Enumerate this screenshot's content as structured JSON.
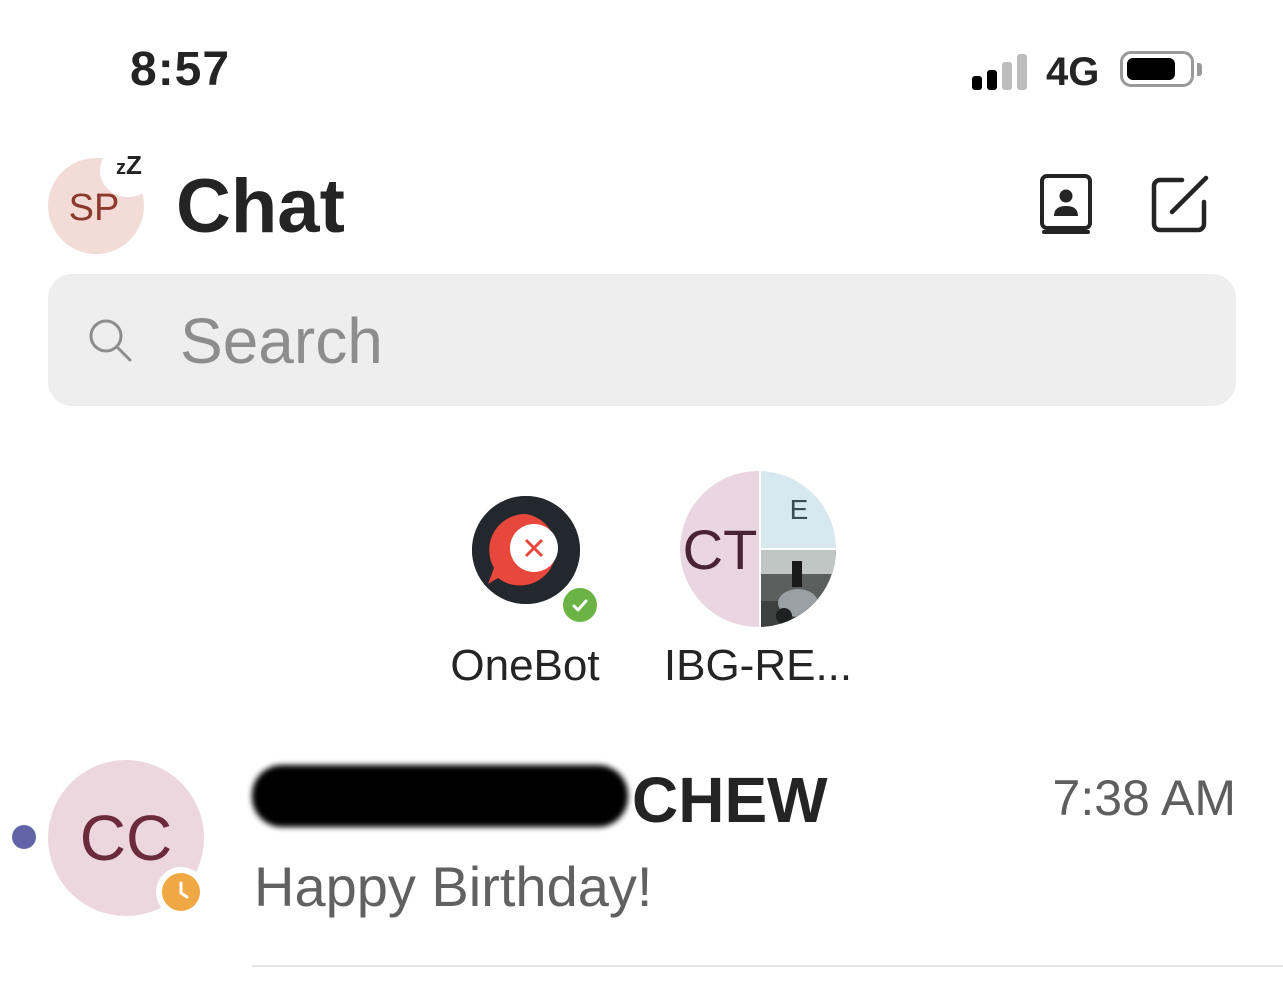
{
  "status_bar": {
    "time": "8:57",
    "network": "4G",
    "signal_bars_active": 2,
    "signal_bars_total": 4,
    "battery_level": 0.75
  },
  "header": {
    "avatar_initials": "SP",
    "presence_badge": "zZ",
    "title": "Chat",
    "contacts_icon": "contacts-book-icon",
    "compose_icon": "compose-icon"
  },
  "search": {
    "placeholder": "Search",
    "icon": "search-icon"
  },
  "pinned": [
    {
      "label": "OneBot",
      "status": "available"
    },
    {
      "label": "IBG-RE...",
      "avatar_initials": "CT",
      "avatar_secondary_initial": "E"
    }
  ],
  "chats": [
    {
      "avatar_initials": "CC",
      "name_visible": "CHEW",
      "time": "7:38 AM",
      "preview": "Happy Birthday!",
      "unread": true,
      "status": "away"
    }
  ],
  "colors": {
    "accent": "#6264a7",
    "available": "#6bb344",
    "away": "#f0a844",
    "onebot_red": "#e8473c"
  }
}
